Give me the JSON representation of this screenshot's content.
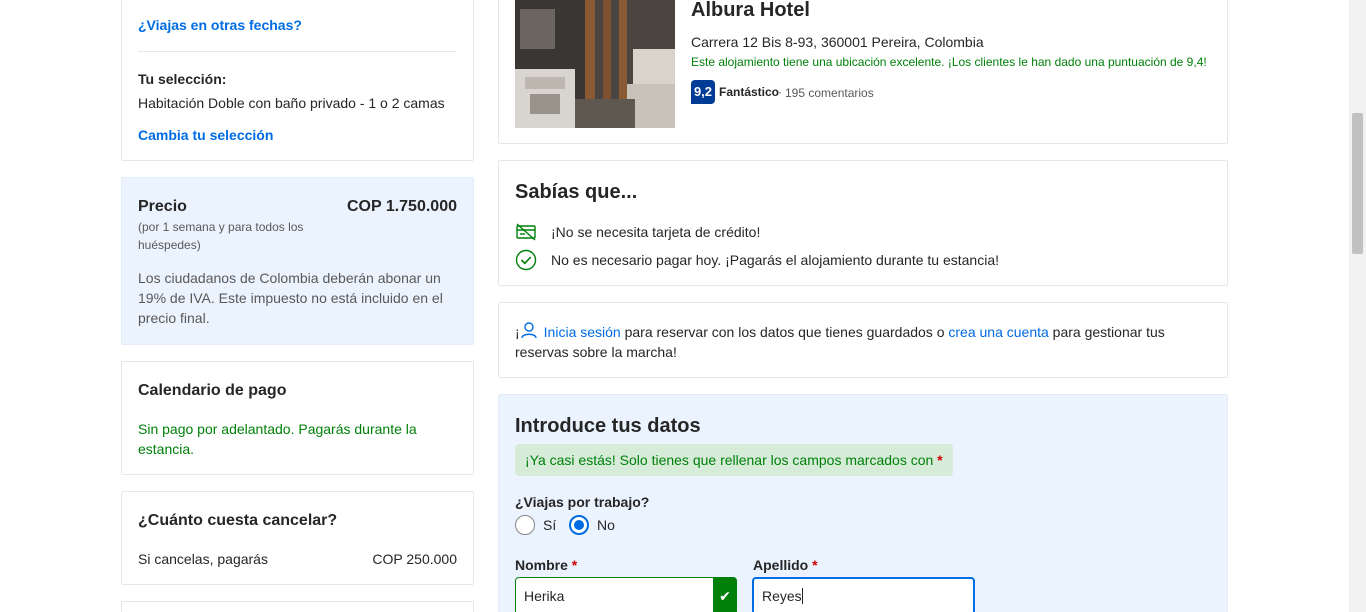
{
  "selection": {
    "other_dates_link": "¿Viajas en otras fechas?",
    "heading": "Tu selección:",
    "room": "Habitación Doble con baño privado - 1 o 2 camas",
    "change_link": "Cambia tu selección"
  },
  "price": {
    "title": "Precio",
    "value": "COP 1.750.000",
    "subtitle": "(por 1 semana y para todos los huéspedes)",
    "tax_note": "Los ciudadanos de Colombia deberán abonar un 19% de IVA. Este impuesto no está incluido en el precio final."
  },
  "payment_schedule": {
    "title": "Calendario de pago",
    "text": "Sin pago por adelantado. Pagarás durante la estancia."
  },
  "cancellation": {
    "title": "¿Cuánto cuesta cancelar?",
    "label": "Si cancelas, pagarás",
    "value": "COP 250.000"
  },
  "hotel": {
    "name": "Albura Hotel",
    "address": "Carrera 12 Bis 8-93, 360001 Pereira, Colombia",
    "location_note": "Este alojamiento tiene una ubicación excelente. ¡Los clientes le han dado una puntuación de 9,4!",
    "score": "9,2",
    "rating_word": "Fantástico",
    "separator": "·",
    "reviews": "195 comentarios"
  },
  "did_you_know": {
    "title": "Sabías que...",
    "items": [
      {
        "icon": "no-credit-card-icon",
        "text": "¡No se necesita tarjeta de crédito!"
      },
      {
        "icon": "check-circle-icon",
        "text": "No es necesario pagar hoy. ¡Pagarás el alojamiento durante tu estancia!"
      }
    ]
  },
  "signin": {
    "prefix": "¡",
    "signin_link": "Inicia sesión",
    "middle": " para reservar con los datos que tienes guardados o ",
    "create_link": "crea una cuenta",
    "suffix": " para gestionar tus reservas sobre la marcha!"
  },
  "details": {
    "title": "Introduce tus datos",
    "note": "¡Ya casi estás! Solo tienes que rellenar los campos marcados con",
    "required_mark": "*",
    "work_question": "¿Viajas por trabajo?",
    "work_options": [
      "Sí",
      "No"
    ],
    "work_selected": "No",
    "first_name_label": "Nombre",
    "first_name_value": "Herika",
    "last_name_label": "Apellido",
    "last_name_value": "Reyes",
    "valid_mark": "✔"
  },
  "colors": {
    "link": "#006ce4",
    "success": "#008009",
    "score_bg": "#003b95",
    "panel_blue": "#ebf3ff"
  }
}
